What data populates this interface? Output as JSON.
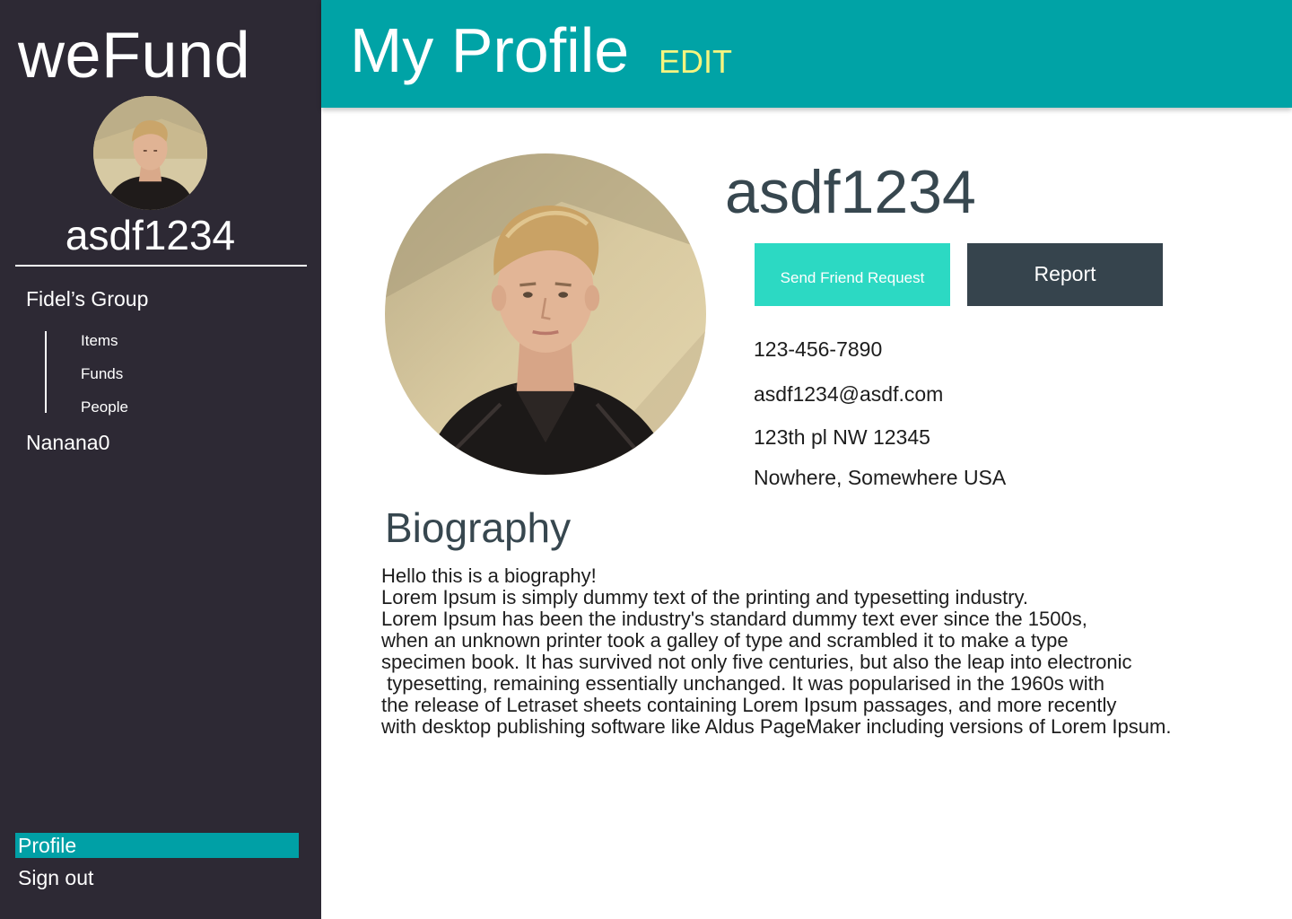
{
  "sidebar": {
    "brand": "weFund",
    "username": "asdf1234",
    "groups": [
      {
        "title": "Fidel’s Group",
        "items": [
          {
            "label": "Items"
          },
          {
            "label": "Funds"
          },
          {
            "label": "People"
          }
        ]
      },
      {
        "title": "Nanana0",
        "items": []
      }
    ],
    "bottom_nav": {
      "profile": "Profile",
      "sign_out": "Sign out"
    },
    "colors": {
      "background": "#2d2934",
      "active_item": "#00a0a6"
    }
  },
  "header": {
    "title": "My Profile",
    "edit_label": "EDIT",
    "colors": {
      "background": "#00a3a6",
      "edit": "#f6f57f"
    }
  },
  "profile": {
    "username": "asdf1234",
    "actions": {
      "friend_request": "Send Friend Request",
      "report": "Report"
    },
    "contact": {
      "phone": "123-456-7890",
      "email": "asdf1234@asdf.com",
      "address_line1": "123th pl NW 12345",
      "address_line2": "Nowhere, Somewhere USA"
    },
    "avatar_icon": "user-photo",
    "colors": {
      "friend_button": "#2cd9c3",
      "report_button": "#36444d",
      "heading": "#37474f"
    }
  },
  "biography": {
    "heading": "Biography",
    "text": "Hello this is a biography!\nLorem Ipsum is simply dummy text of the printing and typesetting industry.\nLorem Ipsum has been the industry's standard dummy text ever since the 1500s,\nwhen an unknown printer took a galley of type and scrambled it to make a type\nspecimen book. It has survived not only five centuries, but also the leap into electronic\n typesetting, remaining essentially unchanged. It was popularised in the 1960s with\nthe release of Letraset sheets containing Lorem Ipsum passages, and more recently\nwith desktop publishing software like Aldus PageMaker including versions of Lorem Ipsum."
  }
}
